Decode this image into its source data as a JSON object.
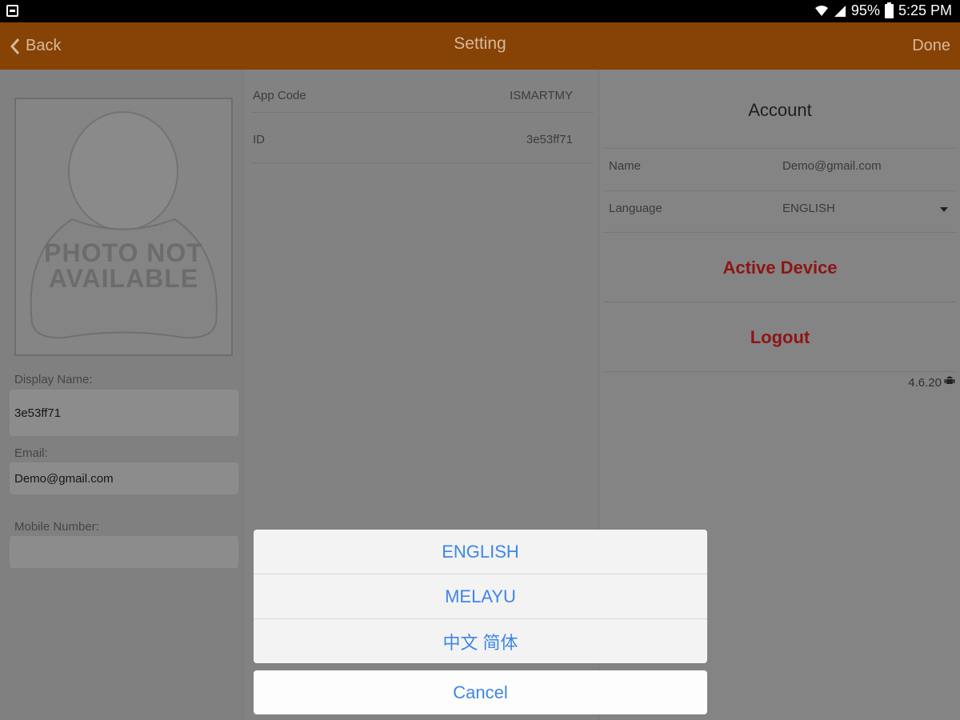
{
  "status_bar": {
    "battery": "95%",
    "time": "5:25 PM"
  },
  "header": {
    "back_label": "Back",
    "title": "Setting",
    "done_label": "Done"
  },
  "profile": {
    "photo_placeholder": "PHOTO NOT AVAILABLE",
    "display_name_label": "Display Name:",
    "display_name_value": "3e53ff71",
    "email_label": "Email:",
    "email_value": "Demo@gmail.com",
    "mobile_label": "Mobile Number:",
    "mobile_value": ""
  },
  "app_info": {
    "rows": [
      {
        "label": "App Code",
        "value": "ISMARTMY"
      },
      {
        "label": "ID",
        "value": "3e53ff71"
      }
    ]
  },
  "account": {
    "title": "Account",
    "name_label": "Name",
    "name_value": "Demo@gmail.com",
    "language_label": "Language",
    "language_value": "ENGLISH",
    "active_device_label": "Active Device",
    "logout_label": "Logout",
    "version": "4.6.20"
  },
  "language_sheet": {
    "options": [
      "ENGLISH",
      "MELAYU",
      "中文 简体"
    ],
    "cancel_label": "Cancel"
  },
  "colors": {
    "header_bg": "#874205",
    "sheet_text": "#3f86e6",
    "action_text": "#8e1515"
  }
}
